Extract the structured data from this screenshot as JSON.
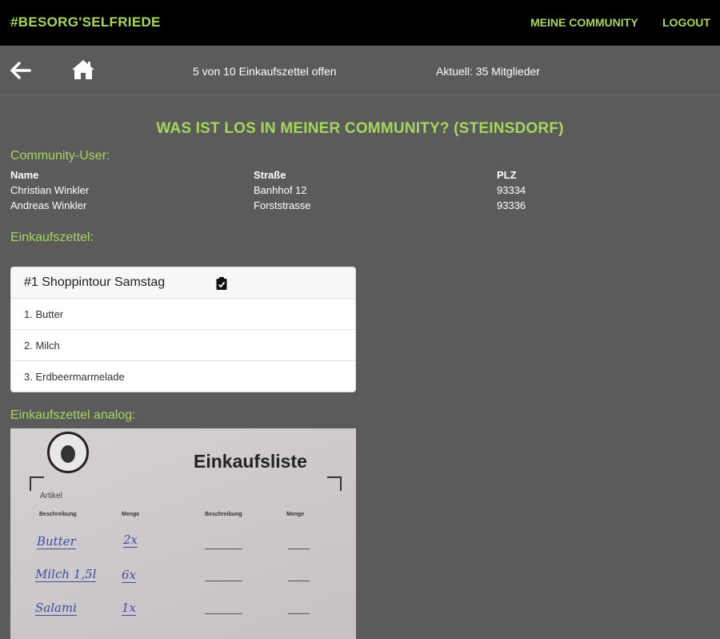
{
  "header": {
    "brand": "#BESORG'SELFRIEDE",
    "nav": {
      "community": "MEINE COMMUNITY",
      "logout": "LOGOUT"
    }
  },
  "subbar": {
    "open_lists": "5 von 10 Einkaufszettel offen",
    "members": "Aktuell: 35 Mitglieder",
    "icons": [
      "arrow-left-icon",
      "home-icon"
    ]
  },
  "page": {
    "title": "WAS IST LOS IN MEINER COMMUNITY? (STEINSDORF)"
  },
  "users": {
    "label": "Community-User:",
    "headers": [
      "Name",
      "Straße",
      "PLZ"
    ],
    "rows": [
      [
        "Christian Winkler",
        "Banhhof 12",
        "93334"
      ],
      [
        "Andreas Winkler",
        "Forststrasse",
        "93336"
      ]
    ]
  },
  "lists": {
    "label": "Einkaufszettel:",
    "card": {
      "title": "#1 Shoppintour Samstag",
      "icon": "clipboard-check-icon",
      "items": [
        "1. Butter",
        "2. Milch",
        "3. Erdbeermarmelade"
      ]
    }
  },
  "analog": {
    "label": "Einkaufszettel analog:",
    "photo": {
      "heading": "Einkaufsliste",
      "section": "Artikel",
      "col_desc": "Beschreibung",
      "col_qty": "Menge",
      "entries": [
        {
          "desc": "Butter",
          "qty": "2x"
        },
        {
          "desc": "Milch 1,5l",
          "qty": "6x"
        },
        {
          "desc": "Salami",
          "qty": "1x"
        }
      ]
    }
  },
  "colors": {
    "accent": "#a6d65c",
    "background": "#5b5b5b",
    "header": "#000000"
  }
}
